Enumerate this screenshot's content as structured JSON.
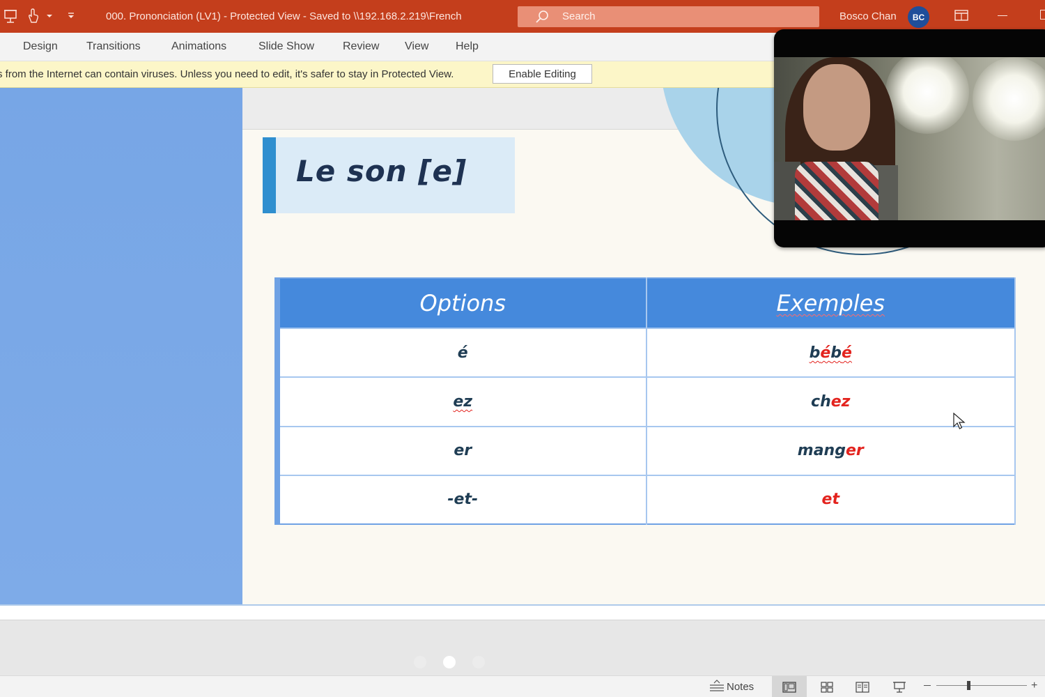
{
  "titlebar": {
    "document_title": "000. Prononciation (LV1)  -  Protected View  -  Saved to \\\\192.168.2.219\\French",
    "search_placeholder": "Search",
    "user_name": "Bosco Chan",
    "user_initials": "BC"
  },
  "ribbon": {
    "tabs": [
      "Design",
      "Transitions",
      "Animations",
      "Slide Show",
      "Review",
      "View",
      "Help"
    ]
  },
  "protected_view": {
    "message": "s from the Internet can contain viruses. Unless you need to edit, it's safer to stay in Protected View.",
    "enable_button": "Enable Editing"
  },
  "slide": {
    "title": "Le son [e]",
    "table": {
      "headers": [
        "Options",
        "Exemples"
      ],
      "rows": [
        {
          "option": "é",
          "example_pre": "b",
          "example_hl1": "é",
          "example_mid": "b",
          "example_hl2": "é"
        },
        {
          "option": "ez",
          "example_pre": "ch",
          "example_hl": "ez"
        },
        {
          "option": "er",
          "example_pre": "mang",
          "example_hl": "er"
        },
        {
          "option": "-et-",
          "example_hl": "et"
        }
      ]
    }
  },
  "status_bar": {
    "notes_label": "Notes"
  },
  "colors": {
    "titlebar": "#c43e1c",
    "table_header": "#4589dc",
    "highlight": "#e3231e",
    "title_accent": "#2f8fcf"
  },
  "icons": {
    "quick_access": [
      "present-from-start-icon",
      "touch-mode-icon",
      "dropdown-icon",
      "customize-toolbar-icon"
    ],
    "view_buttons": [
      "normal-view-icon",
      "slide-sorter-icon",
      "reading-view-icon",
      "slideshow-icon"
    ]
  }
}
